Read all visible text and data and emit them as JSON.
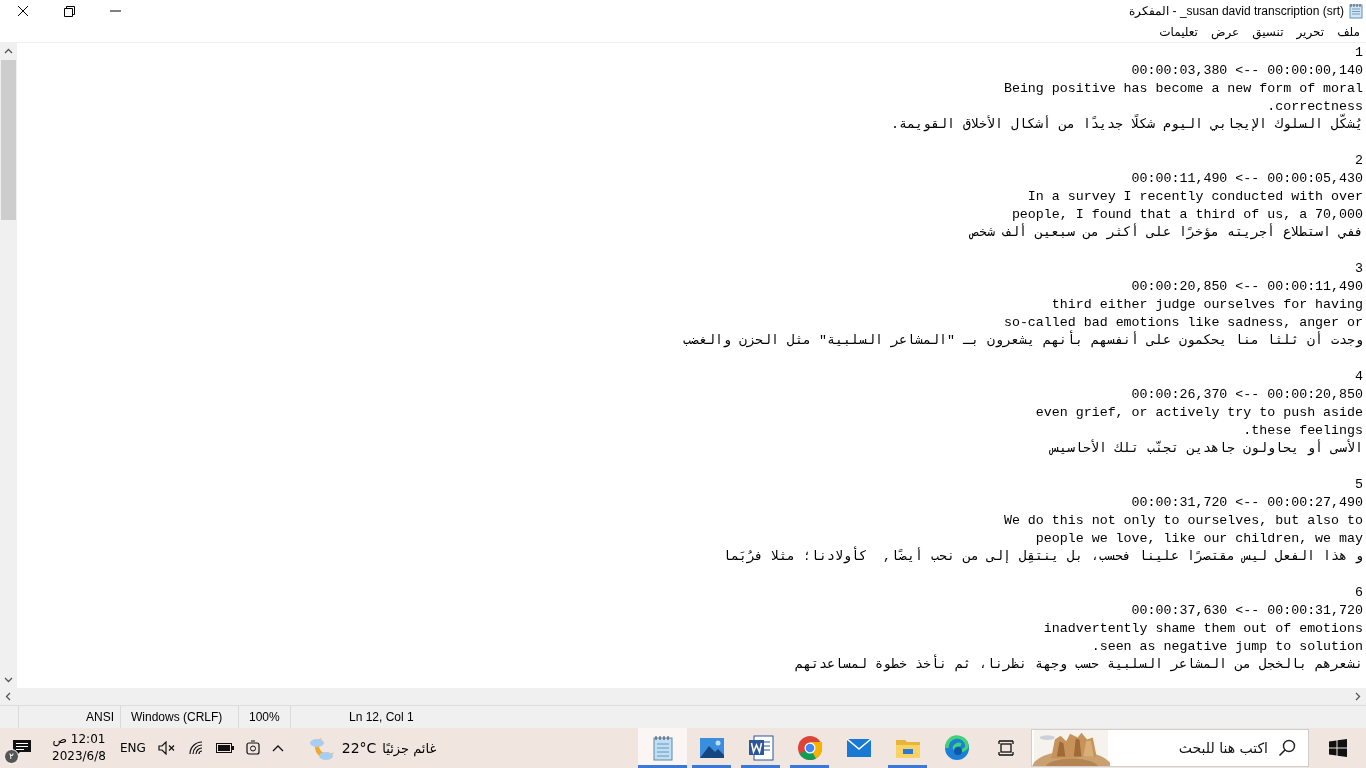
{
  "window": {
    "title": "susan david transcription (srt)_ - المفكرة"
  },
  "menu": [
    {
      "label": "ملف"
    },
    {
      "label": "تحرير"
    },
    {
      "label": "تنسيق"
    },
    {
      "label": "عرض"
    },
    {
      "label": "تعليمات"
    }
  ],
  "editor": {
    "cues": [
      {
        "index": "1",
        "timecode": "00:00:03,380 <-- 00:00:00,140",
        "lines": [
          "Being positive has become a new form of moral",
          ".correctness",
          "يُشكّل السلوك الإيجابي اليوم شكلًا جديدًا من أشكال الأخلاق القويمة."
        ]
      },
      {
        "index": "2",
        "timecode": "00:00:11,490 <-- 00:00:05,430",
        "lines": [
          "In a survey I recently conducted with over",
          "people, I found that a third of us, a 70,000",
          "ففي استطلاع أجريته مؤخرًا على أكثر من سبعين ألف شخص"
        ]
      },
      {
        "index": "3",
        "timecode": "00:00:20,850 <-- 00:00:11,490",
        "lines": [
          "third either judge ourselves for having",
          "so-called bad emotions like sadness, anger or",
          "وجدت أن ثلثا منا يحكمون على أنفسهم بأنهم يشعرون بـ \"المشاعر السلبية\" مثل الحزن والغضب"
        ]
      },
      {
        "index": "4",
        "timecode": "00:00:26,370 <-- 00:00:20,850",
        "lines": [
          "even grief, or actively try to push aside",
          ".these feelings",
          "الأسى أو يحاولون جاهدين تجنّب تلك الأحاسيس"
        ]
      },
      {
        "index": "5",
        "timecode": "00:00:31,720 <-- 00:00:27,490",
        "lines": [
          "We do this not only to ourselves, but also to",
          "people we love, like our children, we may",
          "و هذا الفعل ليس مقتصرًا علينا فحسب، بل ينتقِل إلى من نحب أيضًا,  كأولادنا؛ مثلا فرُبَما"
        ]
      },
      {
        "index": "6",
        "timecode": "00:00:37,630 <-- 00:00:31,720",
        "lines": [
          "inadvertently shame them out of emotions",
          ".seen as negative jump to solution",
          "نشعرهم بالخجل من المشاعر السلبية حسب وجهة نظرنا، ثم نأخذ خطوة لمساعدتهم"
        ]
      }
    ]
  },
  "status_bar": [
    {
      "kind": "position",
      "text": "Ln 12, Col 1"
    },
    {
      "kind": "zoom",
      "text": "100%"
    },
    {
      "kind": "line_ending",
      "text": "Windows (CRLF)"
    },
    {
      "kind": "encoding",
      "text": "ANSI"
    }
  ],
  "taskbar": {
    "search": {
      "placeholder": "اكتب هنا للبحث"
    },
    "apps": [
      {
        "kind": "taskview",
        "running": false,
        "selected": false
      },
      {
        "kind": "edge",
        "running": false,
        "selected": false
      },
      {
        "kind": "explorer",
        "running": true,
        "selected": false
      },
      {
        "kind": "mail",
        "running": false,
        "selected": false
      },
      {
        "kind": "chrome",
        "running": true,
        "selected": false
      },
      {
        "kind": "word",
        "running": true,
        "selected": false
      },
      {
        "kind": "photos",
        "running": true,
        "selected": false
      },
      {
        "kind": "notepad",
        "running": true,
        "selected": true
      }
    ],
    "weather": {
      "temperature": "22°C",
      "condition": "غائم جزئيًا"
    },
    "language": "ENG",
    "clock": {
      "time": "12:01 ص",
      "date": "2023/6/8"
    },
    "notifications": {
      "count": "٢"
    }
  }
}
